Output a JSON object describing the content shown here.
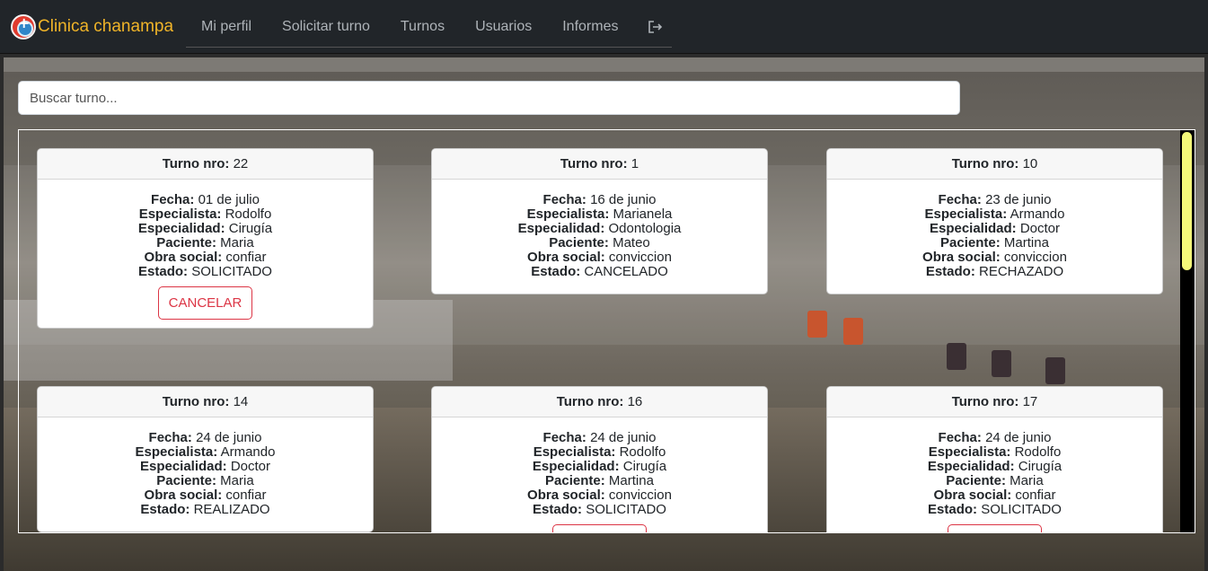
{
  "navbar": {
    "brand": "Clinica chanampa",
    "links": [
      "Mi perfil",
      "Solicitar turno",
      "Turnos",
      "Usuarios",
      "Informes"
    ]
  },
  "search": {
    "placeholder": "Buscar turno..."
  },
  "labels": {
    "turno": "Turno nro:",
    "fecha": "Fecha:",
    "especialista": "Especialista:",
    "especialidad": "Especialidad:",
    "paciente": "Paciente:",
    "obra_social": "Obra social:",
    "estado": "Estado:",
    "cancel": "CANCELAR"
  },
  "cards": [
    {
      "nro": "22",
      "fecha": "01 de julio",
      "especialista": "Rodolfo",
      "especialidad": "Cirugía",
      "paciente": "Maria",
      "obra_social": "confiar",
      "estado": "SOLICITADO"
    },
    {
      "nro": "1",
      "fecha": "16 de junio",
      "especialista": "Marianela",
      "especialidad": "Odontologia",
      "paciente": "Mateo",
      "obra_social": "conviccion",
      "estado": "CANCELADO"
    },
    {
      "nro": "10",
      "fecha": "23 de junio",
      "especialista": "Armando",
      "especialidad": "Doctor",
      "paciente": "Martina",
      "obra_social": "conviccion",
      "estado": "RECHAZADO"
    },
    {
      "nro": "14",
      "fecha": "24 de junio",
      "especialista": "Armando",
      "especialidad": "Doctor",
      "paciente": "Maria",
      "obra_social": "confiar",
      "estado": "REALIZADO"
    },
    {
      "nro": "16",
      "fecha": "24 de junio",
      "especialista": "Rodolfo",
      "especialidad": "Cirugía",
      "paciente": "Martina",
      "obra_social": "conviccion",
      "estado": "SOLICITADO"
    },
    {
      "nro": "17",
      "fecha": "24 de junio",
      "especialista": "Rodolfo",
      "especialidad": "Cirugía",
      "paciente": "Maria",
      "obra_social": "confiar",
      "estado": "SOLICITADO"
    }
  ],
  "colors": {
    "brand": "#f0b429",
    "navbar": "#212529",
    "danger": "#dc3545",
    "scroll_thumb": "#f4f97a"
  },
  "icons": {
    "logo": "clinic-logo-icon",
    "logout": "logout-icon"
  }
}
